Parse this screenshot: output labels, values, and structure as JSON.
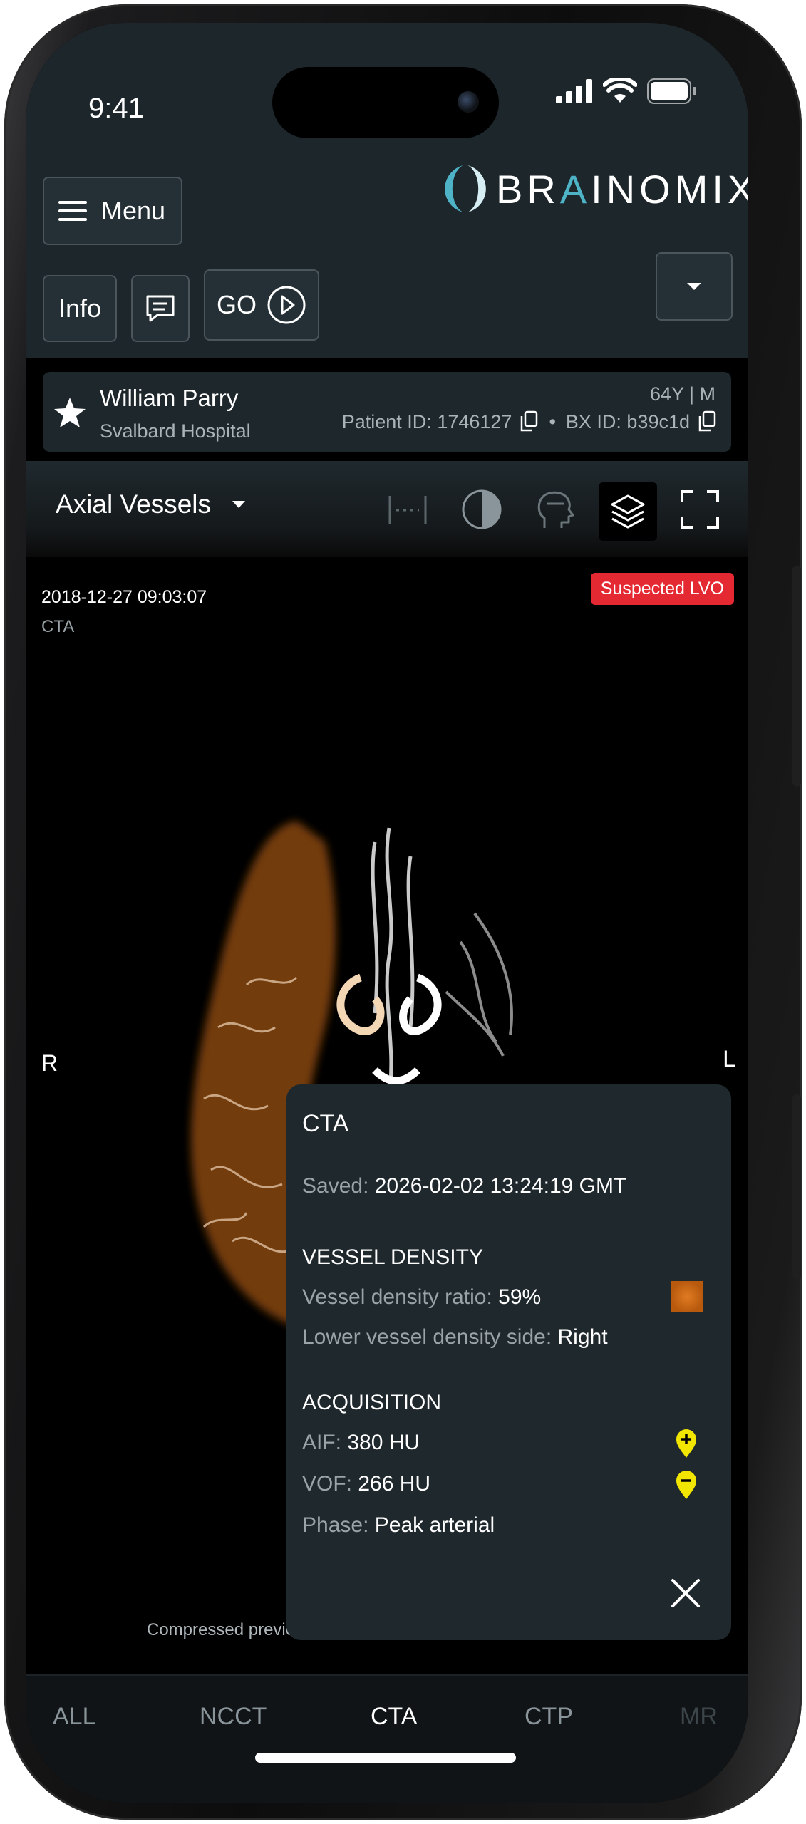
{
  "status_bar": {
    "time": "9:41"
  },
  "brand": {
    "name_pre": "BR",
    "name_accent": "A",
    "name_post": "INOMIX",
    "reg": "®"
  },
  "header": {
    "menu_label": "Menu",
    "info_label": "Info",
    "go_label": "GO"
  },
  "patient": {
    "name": "William Parry",
    "hospital": "Svalbard Hospital",
    "age_sex": "64Y | M",
    "patient_id": "Patient ID: 1746127",
    "separator": "•",
    "bx_id": "BX ID: b39c1d"
  },
  "viewer": {
    "view_name": "Axial Vessels",
    "timestamp": "2018-12-27 09:03:07",
    "modality": "CTA",
    "badge": "Suspected LVO",
    "side_right": "R",
    "side_left": "L",
    "footnote": "Compressed preview. Not for diagnostic use."
  },
  "popup": {
    "title": "CTA",
    "saved_label": "Saved:",
    "saved_value": "2026-02-02 13:24:19 GMT",
    "section_density": "VESSEL DENSITY",
    "density_ratio_label": "Vessel density ratio:",
    "density_ratio_value": "59%",
    "lower_side_label": "Lower vessel density side:",
    "lower_side_value": "Right",
    "section_acq": "ACQUISITION",
    "aif_label": "AIF:",
    "aif_value": "380 HU",
    "vof_label": "VOF:",
    "vof_value": "266 HU",
    "phase_label": "Phase:",
    "phase_value": "Peak arterial"
  },
  "tabs": [
    {
      "label": "ALL"
    },
    {
      "label": "NCCT"
    },
    {
      "label": "CTA"
    },
    {
      "label": "CTP"
    },
    {
      "label": "MR"
    }
  ],
  "colors": {
    "accent_teal": "#4fb3c7",
    "badge_red": "#e42932",
    "density_orange": "#c45d10",
    "marker_yellow": "#f2e600"
  },
  "icons": [
    "menu-icon",
    "chat-icon",
    "play-circle-icon",
    "chevron-down-icon",
    "star-icon",
    "copy-icon",
    "ruler-icon",
    "contrast-icon",
    "head-icon",
    "layers-icon",
    "fullscreen-icon",
    "close-icon"
  ]
}
